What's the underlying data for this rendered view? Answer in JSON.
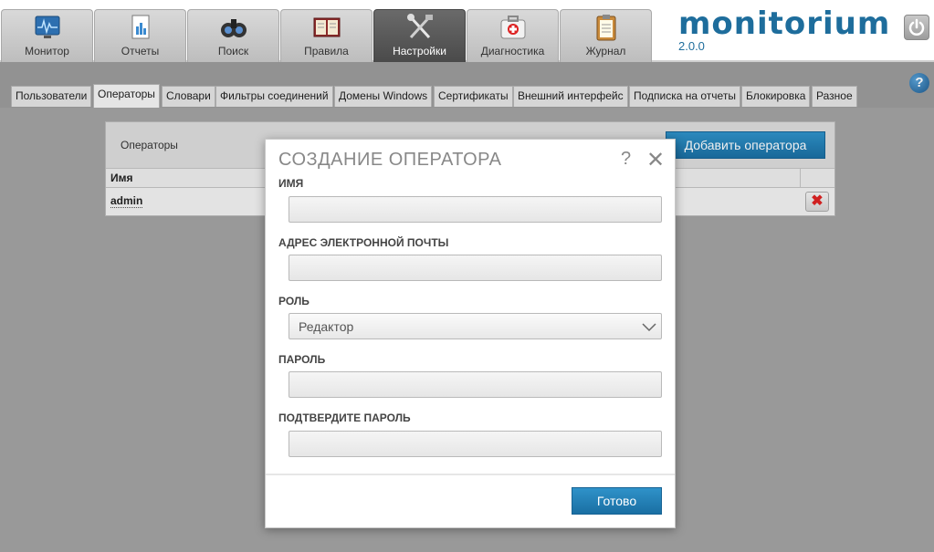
{
  "main_tabs": [
    {
      "label": "Монитор",
      "icon": "monitor-icon"
    },
    {
      "label": "Отчеты",
      "icon": "reports-icon"
    },
    {
      "label": "Поиск",
      "icon": "binoculars-icon"
    },
    {
      "label": "Правила",
      "icon": "rules-book-icon"
    },
    {
      "label": "Настройки",
      "icon": "tools-icon",
      "active": true
    },
    {
      "label": "Диагностика",
      "icon": "first-aid-icon"
    },
    {
      "label": "Журнал",
      "icon": "clipboard-icon"
    }
  ],
  "brand": {
    "logo": "monitorium",
    "version": "2.0.0",
    "color": "#1e6d9c"
  },
  "sub_tabs": [
    {
      "label": "Пользователи"
    },
    {
      "label": "Операторы",
      "active": true
    },
    {
      "label": "Словари"
    },
    {
      "label": "Фильтры соединений"
    },
    {
      "label": "Домены Windows"
    },
    {
      "label": "Сертификаты"
    },
    {
      "label": "Внешний интерфейс"
    },
    {
      "label": "Подписка на отчеты"
    },
    {
      "label": "Блокировка"
    },
    {
      "label": "Разное"
    }
  ],
  "operators_panel": {
    "title": "Операторы",
    "add_button": "Добавить оператора",
    "column_name": "Имя",
    "rows": [
      {
        "name": "admin"
      }
    ]
  },
  "modal": {
    "title": "СОЗДАНИЕ ОПЕРАТОРА",
    "help": "?",
    "close": "✕",
    "fields": {
      "name_label": "ИМЯ",
      "name_value": "",
      "email_label": "АДРЕС ЭЛЕКТРОННОЙ ПОЧТЫ",
      "email_value": "",
      "role_label": "РОЛЬ",
      "role_value": "Редактор",
      "password_label": "ПАРОЛЬ",
      "password_value": "",
      "confirm_label": "ПОДТВЕРДИТЕ ПАРОЛЬ",
      "confirm_value": ""
    },
    "done_button": "Готово"
  },
  "help_badge": "?",
  "accent": "#1a7fbf"
}
